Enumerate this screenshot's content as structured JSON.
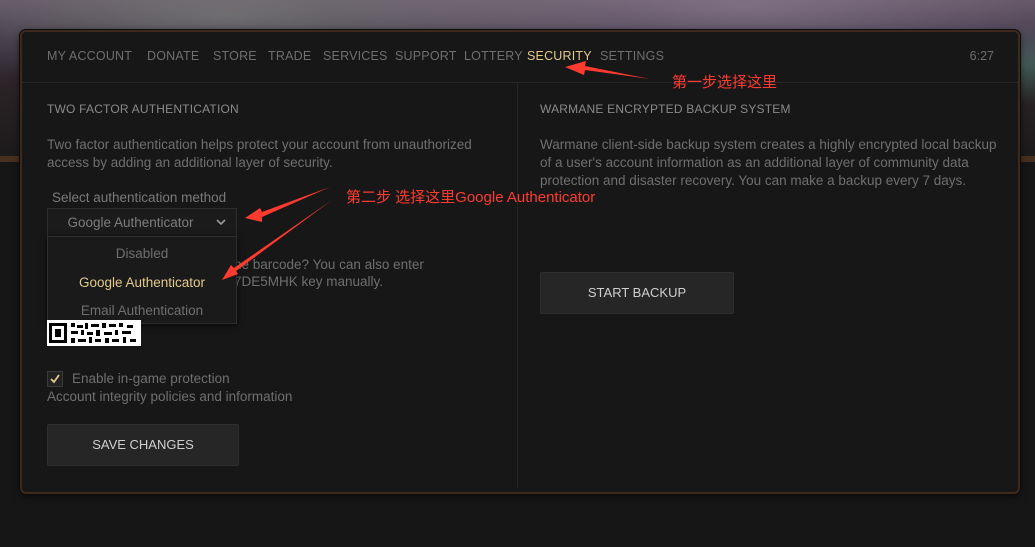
{
  "nav": {
    "items": [
      {
        "label": "MY ACCOUNT"
      },
      {
        "label": "DONATE"
      },
      {
        "label": "STORE"
      },
      {
        "label": "TRADE"
      },
      {
        "label": "SERVICES"
      },
      {
        "label": "SUPPORT"
      },
      {
        "label": "LOTTERY"
      },
      {
        "label": "SECURITY",
        "active": true
      },
      {
        "label": "SETTINGS"
      }
    ],
    "time": "6:27"
  },
  "tfa": {
    "title": "TWO FACTOR AUTHENTICATION",
    "description_line1": "Two factor authentication helps protect your account from unauthorized",
    "description_line2": "access by adding an additional layer of security.",
    "select_label": "Select authentication method",
    "selected": "Google Authenticator",
    "options": [
      "Disabled",
      "Google Authenticator",
      "Email Authentication"
    ],
    "barcode_text_line1": "ne barcode? You can also enter",
    "barcode_text_line2": "7DE5MHK key manually.",
    "ingame_label": "Enable in-game protection",
    "ingame_checked": true,
    "integrity_text": "Account integrity policies and information",
    "save_label": "SAVE CHANGES"
  },
  "backup": {
    "title": "WARMANE ENCRYPTED BACKUP SYSTEM",
    "line1": "Warmane client-side backup system creates a highly encrypted local backup",
    "line2": "of a user's account information as an additional layer of community data",
    "line3": "protection and disaster recovery. You can make a backup every 7 days.",
    "button_label": "START BACKUP"
  },
  "annotations": {
    "step1": "第一步选择这里",
    "step2": "第二步 选择这里Google Authenticator"
  },
  "colors": {
    "accent_gold": "#e3c98a",
    "annotation_red": "#ff3b2f",
    "panel_bg": "#171717",
    "frame_brown": "#3e2a1c"
  }
}
